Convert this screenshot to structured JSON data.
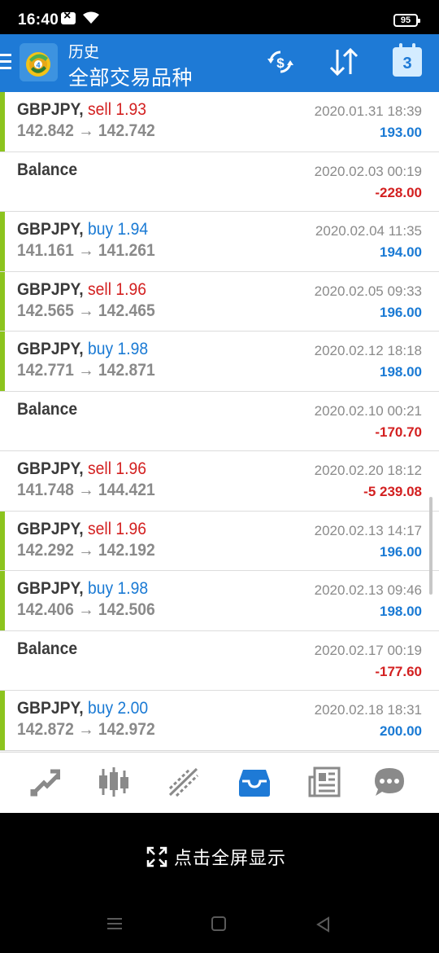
{
  "status_bar": {
    "time": "16:40",
    "battery": "95"
  },
  "header": {
    "subtitle": "历史",
    "title": "全部交易品种",
    "calendar_day": "3"
  },
  "trades": [
    {
      "type": "trade",
      "symbol": "GBPJPY,",
      "side": "sell",
      "volume": "1.93",
      "open": "142.842",
      "close": "142.742",
      "arrow": "→",
      "date": "2020.01.31 18:39",
      "profit": "193.00",
      "profit_sign": "pos",
      "bar": true
    },
    {
      "type": "balance",
      "label": "Balance",
      "date": "2020.02.03 00:19",
      "profit": "-228.00",
      "profit_sign": "neg",
      "bar": false
    },
    {
      "type": "trade",
      "symbol": "GBPJPY,",
      "side": "buy",
      "volume": "1.94",
      "open": "141.161",
      "close": "141.261",
      "arrow": "→",
      "date": "2020.02.04 11:35",
      "profit": "194.00",
      "profit_sign": "pos",
      "bar": true
    },
    {
      "type": "trade",
      "symbol": "GBPJPY,",
      "side": "sell",
      "volume": "1.96",
      "open": "142.565",
      "close": "142.465",
      "arrow": "→",
      "date": "2020.02.05 09:33",
      "profit": "196.00",
      "profit_sign": "pos",
      "bar": true
    },
    {
      "type": "trade",
      "symbol": "GBPJPY,",
      "side": "buy",
      "volume": "1.98",
      "open": "142.771",
      "close": "142.871",
      "arrow": "→",
      "date": "2020.02.12 18:18",
      "profit": "198.00",
      "profit_sign": "pos",
      "bar": true
    },
    {
      "type": "balance",
      "label": "Balance",
      "date": "2020.02.10 00:21",
      "profit": "-170.70",
      "profit_sign": "neg",
      "bar": false
    },
    {
      "type": "trade",
      "symbol": "GBPJPY,",
      "side": "sell",
      "volume": "1.96",
      "open": "141.748",
      "close": "144.421",
      "arrow": "→",
      "date": "2020.02.20 18:12",
      "profit": "-5 239.08",
      "profit_sign": "neg",
      "bar": false
    },
    {
      "type": "trade",
      "symbol": "GBPJPY,",
      "side": "sell",
      "volume": "1.96",
      "open": "142.292",
      "close": "142.192",
      "arrow": "→",
      "date": "2020.02.13 14:17",
      "profit": "196.00",
      "profit_sign": "pos",
      "bar": true
    },
    {
      "type": "trade",
      "symbol": "GBPJPY,",
      "side": "buy",
      "volume": "1.98",
      "open": "142.406",
      "close": "142.506",
      "arrow": "→",
      "date": "2020.02.13 09:46",
      "profit": "198.00",
      "profit_sign": "pos",
      "bar": true
    },
    {
      "type": "balance",
      "label": "Balance",
      "date": "2020.02.17 00:19",
      "profit": "-177.60",
      "profit_sign": "neg",
      "bar": false
    },
    {
      "type": "trade",
      "symbol": "GBPJPY,",
      "side": "buy",
      "volume": "2.00",
      "open": "142.872",
      "close": "142.972",
      "arrow": "→",
      "date": "2020.02.18 18:31",
      "profit": "200.00",
      "profit_sign": "pos",
      "bar": true
    }
  ],
  "bottom_nav": [
    "quotes-icon",
    "chart-icon",
    "trade-icon",
    "history-icon",
    "news-icon",
    "messages-icon"
  ],
  "fullscreen_prompt": "点击全屏显示",
  "colors": {
    "accent": "#1e7ad6",
    "sell": "#d32020",
    "buy": "#1a7ad4",
    "profit_bar": "#8cc41e"
  }
}
